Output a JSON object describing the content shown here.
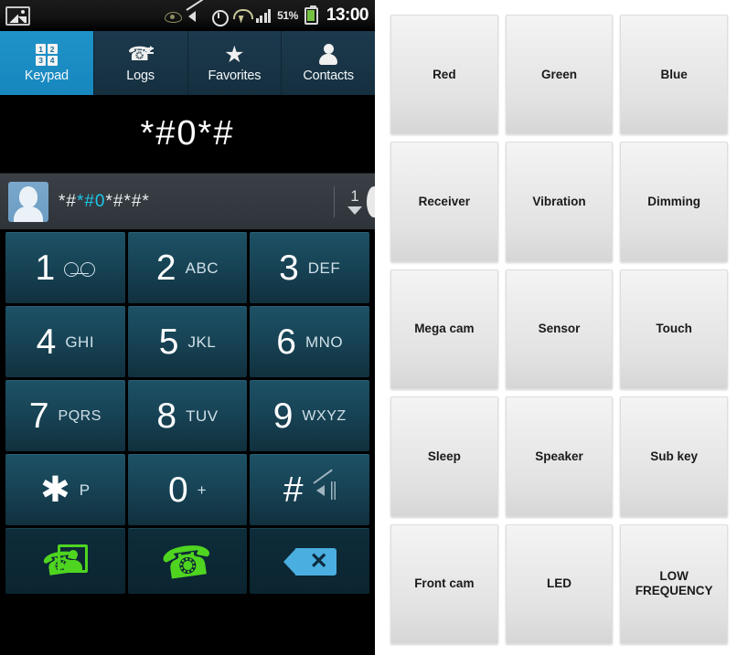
{
  "phone": {
    "status_bar": {
      "gallery_icon": "gallery-icon",
      "icons": [
        "eye-icon",
        "mute-icon",
        "alarm-icon",
        "wifi-icon",
        "signal-icon"
      ],
      "battery_percent": "51%",
      "clock": "13:00"
    },
    "tabs": [
      {
        "label": "Keypad",
        "icon": "keypad-grid-icon",
        "active": true
      },
      {
        "label": "Logs",
        "icon": "call-logs-icon",
        "active": false
      },
      {
        "label": "Favorites",
        "icon": "star-icon",
        "active": false
      },
      {
        "label": "Contacts",
        "icon": "person-icon",
        "active": false
      }
    ],
    "display": {
      "number": "*#0*#"
    },
    "suggestion": {
      "prefix": "*#",
      "highlight": "*#0",
      "suffix": "*#*#*",
      "count": "1",
      "expand_icon": "chevron-down-icon"
    },
    "keypad": {
      "rows": [
        [
          {
            "digit": "1",
            "sub": "",
            "icon": "voicemail-icon"
          },
          {
            "digit": "2",
            "sub": "ABC",
            "icon": ""
          },
          {
            "digit": "3",
            "sub": "DEF",
            "icon": ""
          }
        ],
        [
          {
            "digit": "4",
            "sub": "GHI",
            "icon": ""
          },
          {
            "digit": "5",
            "sub": "JKL",
            "icon": ""
          },
          {
            "digit": "6",
            "sub": "MNO",
            "icon": ""
          }
        ],
        [
          {
            "digit": "7",
            "sub": "PQRS",
            "icon": ""
          },
          {
            "digit": "8",
            "sub": "TUV",
            "icon": ""
          },
          {
            "digit": "9",
            "sub": "WXYZ",
            "icon": ""
          }
        ],
        [
          {
            "digit": "✱",
            "sub": "P",
            "icon": ""
          },
          {
            "digit": "0",
            "sub": "+",
            "icon": ""
          },
          {
            "digit": "#",
            "sub": "",
            "icon": "vibrate-off-icon"
          }
        ]
      ],
      "actions": [
        {
          "icon": "video-call-icon",
          "label": ""
        },
        {
          "icon": "call-icon",
          "label": ""
        },
        {
          "icon": "backspace-icon",
          "label": ""
        }
      ]
    }
  },
  "test_menu": {
    "buttons": [
      "Red",
      "Green",
      "Blue",
      "Receiver",
      "Vibration",
      "Dimming",
      "Mega cam",
      "Sensor",
      "Touch",
      "Sleep",
      "Speaker",
      "Sub key",
      "Front cam",
      "LED",
      "LOW FREQUENCY"
    ]
  },
  "colors": {
    "tab_active": "#1f93c9",
    "tab_inactive": "#1c3a4d",
    "key_bg": "#1d5165",
    "call_green": "#4fd420",
    "delete_blue": "#4aaee0",
    "highlight_cyan": "#1ec6e8",
    "battery_green": "#76c043"
  }
}
